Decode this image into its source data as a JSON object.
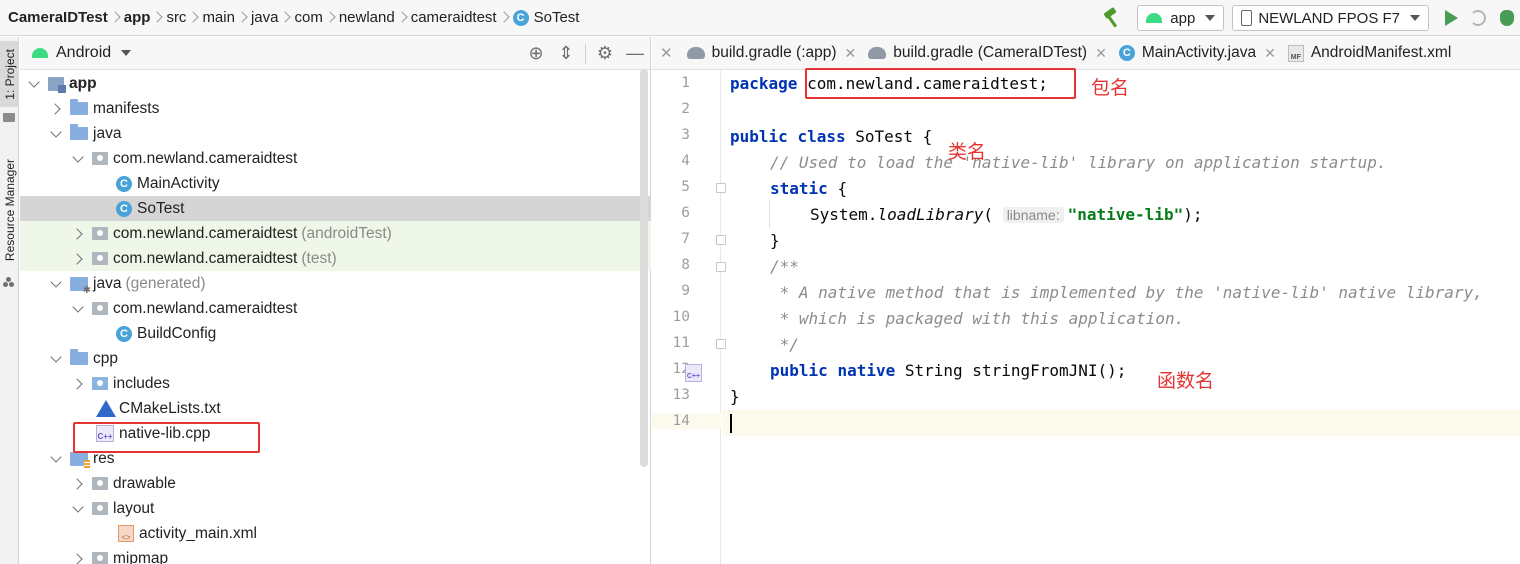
{
  "breadcrumbs": [
    "CameraIDTest",
    "app",
    "src",
    "main",
    "java",
    "com",
    "newland",
    "cameraidtest",
    "SoTest"
  ],
  "toolbar": {
    "run_config": "app",
    "device": "NEWLAND FPOS F7"
  },
  "side_tabs": {
    "project": "1: Project",
    "resource_manager": "Resource Manager"
  },
  "project_panel": {
    "view_mode": "Android"
  },
  "tree": [
    {
      "label": "app",
      "suffix": ""
    },
    {
      "label": "manifests",
      "suffix": ""
    },
    {
      "label": "java",
      "suffix": ""
    },
    {
      "label": "com.newland.cameraidtest",
      "suffix": ""
    },
    {
      "label": "MainActivity",
      "suffix": ""
    },
    {
      "label": "SoTest",
      "suffix": ""
    },
    {
      "label": "com.newland.cameraidtest",
      "suffix": "(androidTest)"
    },
    {
      "label": "com.newland.cameraidtest",
      "suffix": "(test)"
    },
    {
      "label": "java",
      "suffix": "(generated)"
    },
    {
      "label": "com.newland.cameraidtest",
      "suffix": ""
    },
    {
      "label": "BuildConfig",
      "suffix": ""
    },
    {
      "label": "cpp",
      "suffix": ""
    },
    {
      "label": "includes",
      "suffix": ""
    },
    {
      "label": "CMakeLists.txt",
      "suffix": ""
    },
    {
      "label": "native-lib.cpp",
      "suffix": ""
    },
    {
      "label": "res",
      "suffix": ""
    },
    {
      "label": "drawable",
      "suffix": ""
    },
    {
      "label": "layout",
      "suffix": ""
    },
    {
      "label": "activity_main.xml",
      "suffix": ""
    },
    {
      "label": "mipmap",
      "suffix": ""
    }
  ],
  "editor_tabs": [
    {
      "label": "build.gradle (:app)"
    },
    {
      "label": "build.gradle (CameraIDTest)"
    },
    {
      "label": "MainActivity.java"
    },
    {
      "label": "AndroidManifest.xml"
    }
  ],
  "code": {
    "line_numbers": [
      "1",
      "2",
      "3",
      "4",
      "5",
      "6",
      "7",
      "8",
      "9",
      "10",
      "11",
      "12",
      "13",
      "14"
    ],
    "l1_kw": "package",
    "l1_rest": "com.newland.cameraidtest;",
    "l3_kw1": "public",
    "l3_kw2": "class",
    "l3_rest": "SoTest {",
    "l4": "// Used to load the 'native-lib' library on application startup.",
    "l5_kw": "static",
    "l5_rest": "{",
    "l6_pre": "System.",
    "l6_call": "loadLibrary",
    "l6_open": "(",
    "l6_hint": "libname:",
    "l6_str": "\"native-lib\"",
    "l6_close": ");",
    "l7": "}",
    "l8": "/**",
    "l9": " * A native method that is implemented by the 'native-lib' native library,",
    "l10": " * which is packaged with this application.",
    "l11": " */",
    "l12_kw1": "public",
    "l12_kw2": "native",
    "l12_rest": "String stringFromJNI();",
    "l13": "}"
  },
  "annotations": {
    "package_name": "包名",
    "class_name": "类名",
    "function_name": "函数名"
  },
  "colors": {
    "annotation_red": "#e53333",
    "keyword_blue": "#0033b3",
    "string_green": "#067d17",
    "comment_gray": "#8c8c8c"
  }
}
